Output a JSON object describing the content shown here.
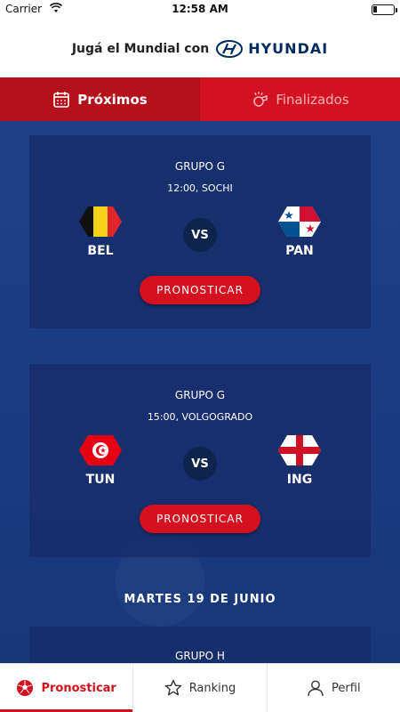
{
  "status_bar": {
    "carrier": "Carrier",
    "time": "12:58 AM"
  },
  "header": {
    "sponsor_text": "Jugá el Mundial con",
    "brand": "HYUNDAI",
    "brand_color": "#002c5f"
  },
  "tabs": [
    {
      "label": "Próximos",
      "icon": "calendar-icon",
      "active": true
    },
    {
      "label": "Finalizados",
      "icon": "whistle-icon",
      "active": false
    }
  ],
  "matches": [
    {
      "group": "GRUPO G",
      "when": "12:00, SOCHI",
      "home": {
        "code": "BEL",
        "flag": "belgium-flag"
      },
      "away": {
        "code": "PAN",
        "flag": "panama-flag"
      },
      "vs": "VS",
      "action": "PRONOSTICAR"
    },
    {
      "group": "GRUPO G",
      "when": "15:00, VOLGOGRADO",
      "home": {
        "code": "TUN",
        "flag": "tunisia-flag"
      },
      "away": {
        "code": "ING",
        "flag": "england-flag"
      },
      "vs": "VS",
      "action": "PRONOSTICAR"
    }
  ],
  "day_heading": "MARTES 19 DE JUNIO",
  "partial_match": {
    "group": "GRUPO H"
  },
  "bottom_nav": [
    {
      "label": "Pronosticar",
      "icon": "soccer-ball-icon",
      "active": true
    },
    {
      "label": "Ranking",
      "icon": "star-icon",
      "active": false
    },
    {
      "label": "Perfil",
      "icon": "user-icon",
      "active": false
    }
  ],
  "colors": {
    "primary_red": "#d31120",
    "active_tab": "#b3111b",
    "background_blue": "#1c3f88"
  }
}
